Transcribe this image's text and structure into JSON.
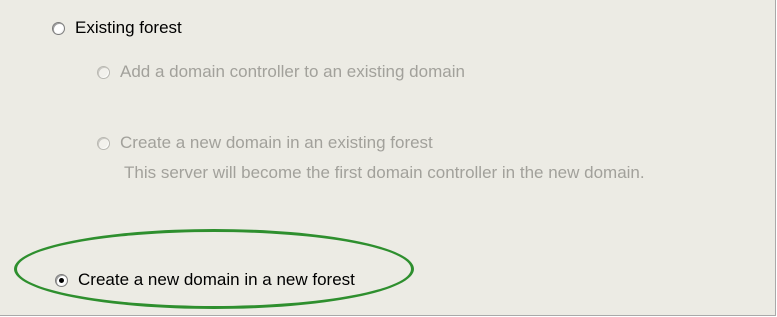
{
  "options": {
    "existing_forest": {
      "label": "Existing forest",
      "selected": false,
      "enabled": true
    },
    "add_domain_controller": {
      "label": "Add a domain controller to an existing domain",
      "selected": false,
      "enabled": false
    },
    "new_domain_existing_forest": {
      "label": "Create a new domain in an existing forest",
      "description": "This server will become the first domain controller in the new domain.",
      "selected": false,
      "enabled": false
    },
    "new_domain_new_forest": {
      "label": "Create a new domain in a new forest",
      "selected": true,
      "enabled": true
    }
  },
  "colors": {
    "panel_background": "#ecebe4",
    "disabled_text": "#a2a19b",
    "highlight_ellipse": "#2e8f2e"
  }
}
